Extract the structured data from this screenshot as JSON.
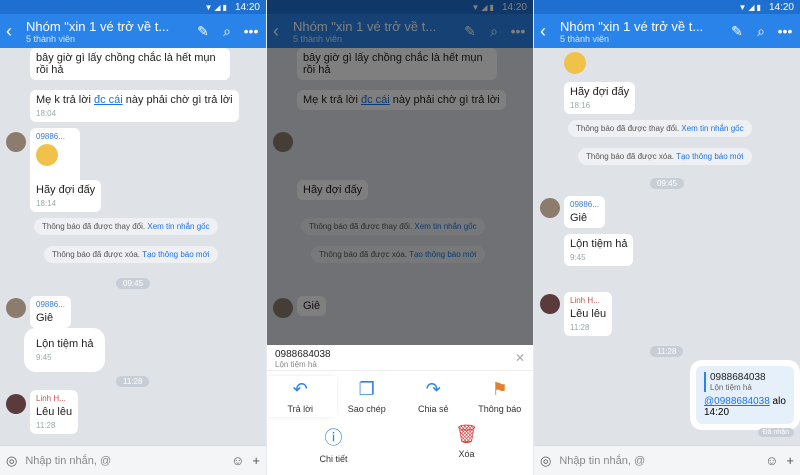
{
  "status_time": "14:20",
  "header": {
    "title": "Nhóm \"xin 1 vé trở về t...",
    "members": "5 thành viên"
  },
  "input": {
    "placeholder": "Nhập tin nhắn, @"
  },
  "screen1": {
    "msg_top": "bây giờ gì lấy chồng chắc là hết mụn rồi hả",
    "msg_me_k_pre": "Mẹ k trả lời",
    "msg_me_k_link": "đc cái",
    "msg_me_k_post": "này phải chờ gì trả lời",
    "msg_me_k_time": "18:04",
    "sender1": "09886...",
    "msg_wait": "Hãy đợi đấy",
    "msg_wait_time": "18:14",
    "sys1_text": "Thông báo đã được thay đổi.",
    "sys1_link": "Xem tin nhắn gốc",
    "sys2_text": "Thông báo đã được xóa.",
    "sys2_link": "Tạo thông báo mới",
    "pill1": "09:45",
    "sender2": "09886...",
    "msg_gie": "Giê",
    "msg_lon": "Lộn tiệm hả",
    "msg_lon_time": "9:45",
    "pill2": "11:28",
    "sender3": "Linh H...",
    "msg_leu": "Lêu lêu",
    "msg_leu_time": "11:28"
  },
  "screen2": {
    "reply_name": "0988684038",
    "reply_text": "Lộn tiệm hả",
    "actions": [
      {
        "label": "Trả lời",
        "icon": "reply-icon"
      },
      {
        "label": "Sao chép",
        "icon": "copy-icon"
      },
      {
        "label": "Chia sẻ",
        "icon": "share-icon"
      },
      {
        "label": "Thông báo",
        "icon": "flag-icon"
      },
      {
        "label": "Chi tiết",
        "icon": "info-icon"
      },
      {
        "label": "Xóa",
        "icon": "trash-icon"
      }
    ]
  },
  "screen3": {
    "msg_wait": "Hãy đợi đấy",
    "msg_wait_time": "18:16",
    "sys1_text": "Thông báo đã được thay đổi.",
    "sys1_link": "Xem tin nhắn gốc",
    "sys2_text": "Thông báo đã được xóa.",
    "sys2_link": "Tạo thông báo mới",
    "pill1": "09:45",
    "sender1": "09886...",
    "msg_gie": "Giê",
    "msg_lon": "Lộn tiệm hả",
    "msg_lon_time": "9:45",
    "sender2": "Linh H...",
    "msg_leu": "Lêu lêu",
    "msg_leu_time": "11:28",
    "pill2": "11:28",
    "quote_name": "0988684038",
    "quote_text": "Lộn tiệm hả",
    "reply_mention": "@0988684038",
    "reply_text": " alo",
    "reply_time": "14:20",
    "seen": "Đã nhận"
  }
}
